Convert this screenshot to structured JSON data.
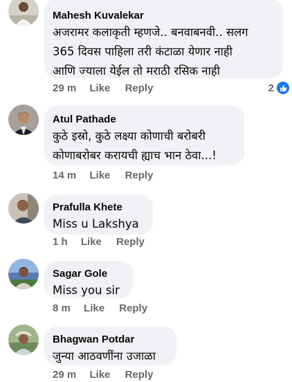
{
  "comments": [
    {
      "author": "Mahesh Kuvalekar",
      "lines": [
        "अजरामर कलाकृती म्हणजे.. बनवाबनवी.. सलग",
        "365 दिवस पाहिला तरी कंटाळा येणार नाही",
        "आणि ज्याला येईल तो मराठी रसिक नाही"
      ],
      "time": "29 m",
      "like": "Like",
      "reply": "Reply",
      "reaction_count": "2"
    },
    {
      "author": "Atul Pathade",
      "lines": [
        "कुठे इस्रो, कुठे लक्ष्या कोणाची बरोबरी",
        "कोणाबरोबर करायची ह्याच भान ठेवा...!"
      ],
      "time": "14 m",
      "like": "Like",
      "reply": "Reply"
    },
    {
      "author": "Prafulla Khete",
      "lines": [
        "Miss u Lakshya"
      ],
      "time": "1 h",
      "like": "Like",
      "reply": "Reply"
    },
    {
      "author": "Sagar Gole",
      "lines": [
        "Miss you sir"
      ],
      "time": "8 m",
      "like": "Like",
      "reply": "Reply"
    },
    {
      "author": "Bhagwan Potdar",
      "lines": [
        "जुन्या आठवणींना उजाळा"
      ],
      "time": "29 m",
      "like": "Like",
      "reply": "Reply"
    }
  ],
  "colors": {
    "bubble": "#f0f2f5",
    "text": "#050505",
    "meta": "#65676b",
    "like_blue": "#1877f2"
  },
  "icons": [
    "like-thumb-icon"
  ]
}
